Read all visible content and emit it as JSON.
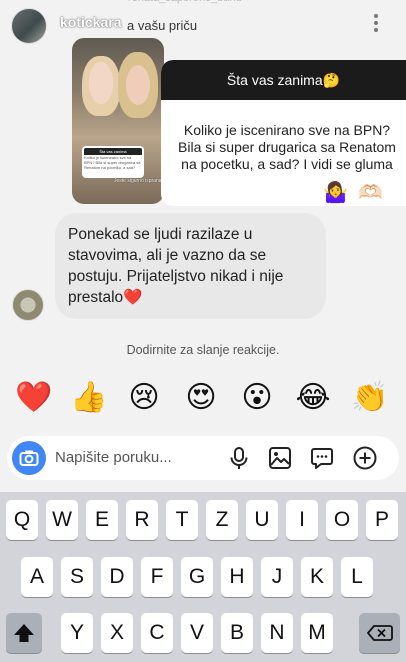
{
  "header": {
    "faded_handle": "renata_saperone_band",
    "username": "kotickara",
    "reply_label": "a vašu priču"
  },
  "story": {
    "card_title": "Šta vas zanima",
    "card_text": "Koliko je iscenirano sve na BPN? Bila si super drugarica sa Renatom na pocetku, a sad?",
    "caption": "Jeste sigurno isprana"
  },
  "question": {
    "title": "Šta vas zanima🤔",
    "text": "Koliko je iscenirano sve na BPN? Bila si super drugarica sa Renatom na pocetku, a sad? I vidi se gluma",
    "emoji_1": "🤷‍♀️",
    "emoji_2": "🫶🏻"
  },
  "message": {
    "text": "Ponekad se ljudi razilaze u stavovima, ali je vazno da se postuju. Prijateljstvo nikad i nije prestalo❤️"
  },
  "reactions": {
    "hint": "Dodirnite za slanje reakcije.",
    "items": [
      "❤️",
      "👍",
      "😢",
      "😍",
      "😮",
      "😂",
      "👏"
    ]
  },
  "composer": {
    "placeholder": "Napišite poruku..."
  },
  "keyboard": {
    "row1": [
      "Q",
      "W",
      "E",
      "R",
      "T",
      "Z",
      "U",
      "I",
      "O",
      "P"
    ],
    "row2": [
      "A",
      "S",
      "D",
      "F",
      "G",
      "H",
      "J",
      "K",
      "L"
    ],
    "row3": [
      "Y",
      "X",
      "C",
      "V",
      "B",
      "N",
      "M"
    ]
  },
  "colors": {
    "camera_button": "#3f87f5",
    "question_header": "#1b1b1b",
    "bubble": "#e8e8e8",
    "keyboard_bg": "#d2d4d9"
  }
}
